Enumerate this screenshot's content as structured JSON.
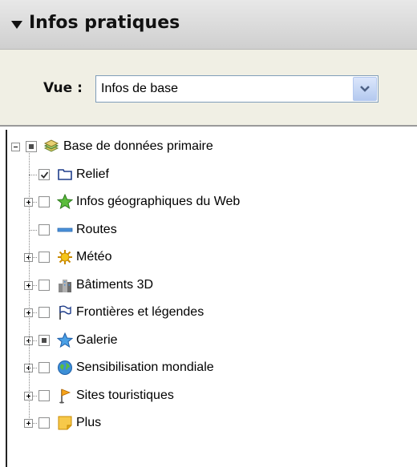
{
  "panel": {
    "title": "Infos pratiques"
  },
  "view": {
    "label": "Vue :",
    "selected": "Infos de base"
  },
  "tree": {
    "root": {
      "label": "Base de données primaire",
      "icon": "layers-icon",
      "state": "partial"
    },
    "items": [
      {
        "label": "Relief",
        "icon": "folder-icon",
        "state": "checked",
        "expandable": false
      },
      {
        "label": "Infos géographiques du Web",
        "icon": "star-green-icon",
        "state": "unchecked",
        "expandable": true
      },
      {
        "label": "Routes",
        "icon": "road-icon",
        "state": "unchecked",
        "expandable": false
      },
      {
        "label": "Météo",
        "icon": "sun-icon",
        "state": "unchecked",
        "expandable": true
      },
      {
        "label": "Bâtiments 3D",
        "icon": "buildings-icon",
        "state": "unchecked",
        "expandable": true
      },
      {
        "label": "Frontières et légendes",
        "icon": "flag-icon",
        "state": "unchecked",
        "expandable": true
      },
      {
        "label": "Galerie",
        "icon": "star-blue-icon",
        "state": "partial",
        "expandable": true
      },
      {
        "label": "Sensibilisation mondiale",
        "icon": "globe-icon",
        "state": "unchecked",
        "expandable": true
      },
      {
        "label": "Sites touristiques",
        "icon": "pin-flag-icon",
        "state": "unchecked",
        "expandable": true
      },
      {
        "label": "Plus",
        "icon": "note-icon",
        "state": "unchecked",
        "expandable": true
      }
    ]
  }
}
